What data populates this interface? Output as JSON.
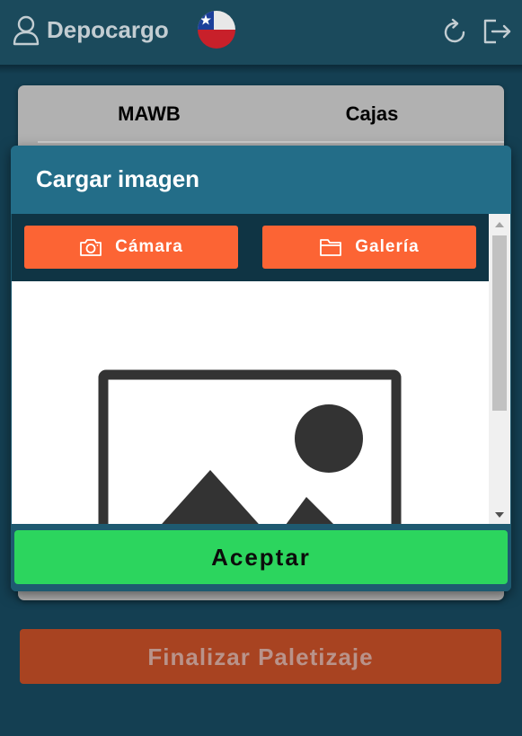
{
  "header": {
    "app_title": "Depocargo",
    "icons": [
      "user-icon",
      "chile-flag-icon",
      "refresh-icon",
      "logout-icon"
    ]
  },
  "tabs": [
    {
      "label": "MAWB"
    },
    {
      "label": "Cajas"
    }
  ],
  "modal": {
    "title": "Cargar imagen",
    "camera_button": "Cámara",
    "gallery_button": "Galería",
    "accept_button": "Aceptar",
    "preview_icon": "image-placeholder-icon"
  },
  "footer": {
    "finalize_button": "Finalizar Paletizaje"
  },
  "colors": {
    "header_bg": "#1b4a5c",
    "page_bg": "#143f52",
    "modal_header": "#236d88",
    "source_button": "#fc6434",
    "accept_button": "#2cd55e",
    "finalize_button": "#a84321"
  }
}
